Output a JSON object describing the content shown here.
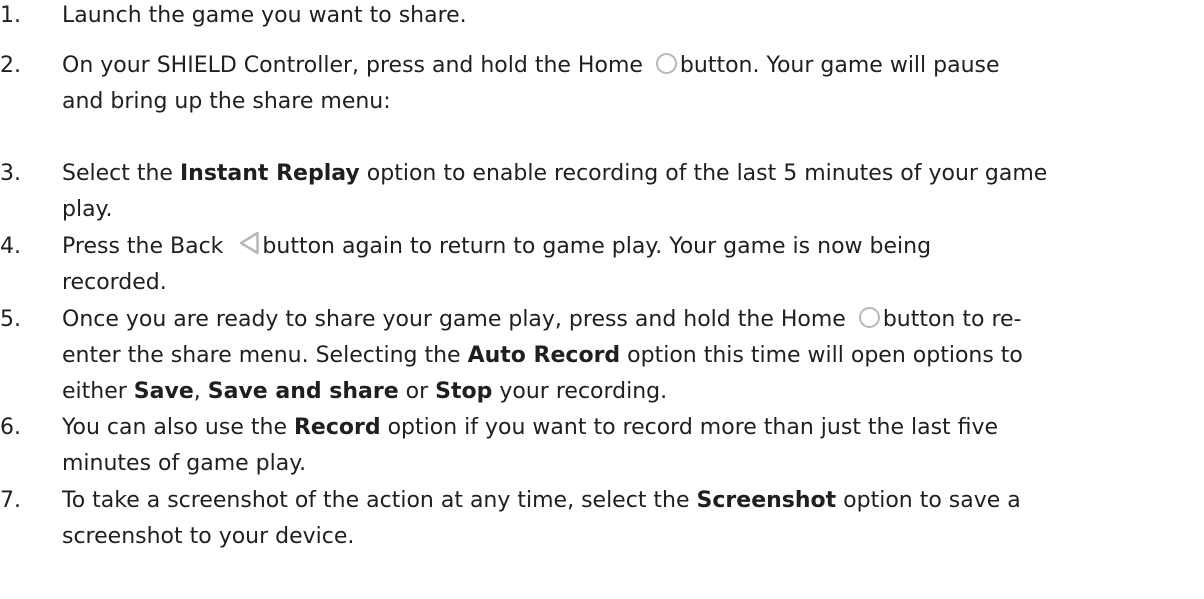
{
  "steps": [
    {
      "num": "1.",
      "text": "Launch the game you want to share."
    },
    {
      "num": "2.",
      "t1": "On your SHIELD Controller, press and hold the Home ",
      "t2": "button.  Your game will pause",
      "t3": "and bring up the share menu:"
    },
    {
      "num": "3.",
      "t1": "Select the ",
      "b1": "Instant Replay",
      "t2": " option to enable recording of the last 5 minutes of your game",
      "t3": "play."
    },
    {
      "num": "4.",
      "t1": "Press the Back ",
      "t2": "button again to return to game play.  Your game is now being",
      "t3": "recorded."
    },
    {
      "num": "5.",
      "t1": "Once you are ready to share your game play, press and hold the Home ",
      "t2": "button to re-",
      "t3": "enter the share menu.  Selecting the ",
      "b1": "Auto Record",
      "t4": " option this time will open options to",
      "t5": "either ",
      "b2": "Save",
      "t6": ", ",
      "b3": "Save and share",
      "t7": " or ",
      "b4": "Stop",
      "t8": " your recording."
    },
    {
      "num": "6.",
      "t1": "You can also use the ",
      "b1": "Record",
      "t2": " option if you want to record more than just the last five",
      "t3": "minutes of game play."
    },
    {
      "num": "7.",
      "t1": "To take a screenshot of the action at any time, select the ",
      "b1": "Screenshot",
      "t2": " option to save a",
      "t3": "screenshot to your device."
    }
  ],
  "icons": {
    "home": "home-circle-icon",
    "back": "back-triangle-icon",
    "color": "#b8b8b8"
  }
}
